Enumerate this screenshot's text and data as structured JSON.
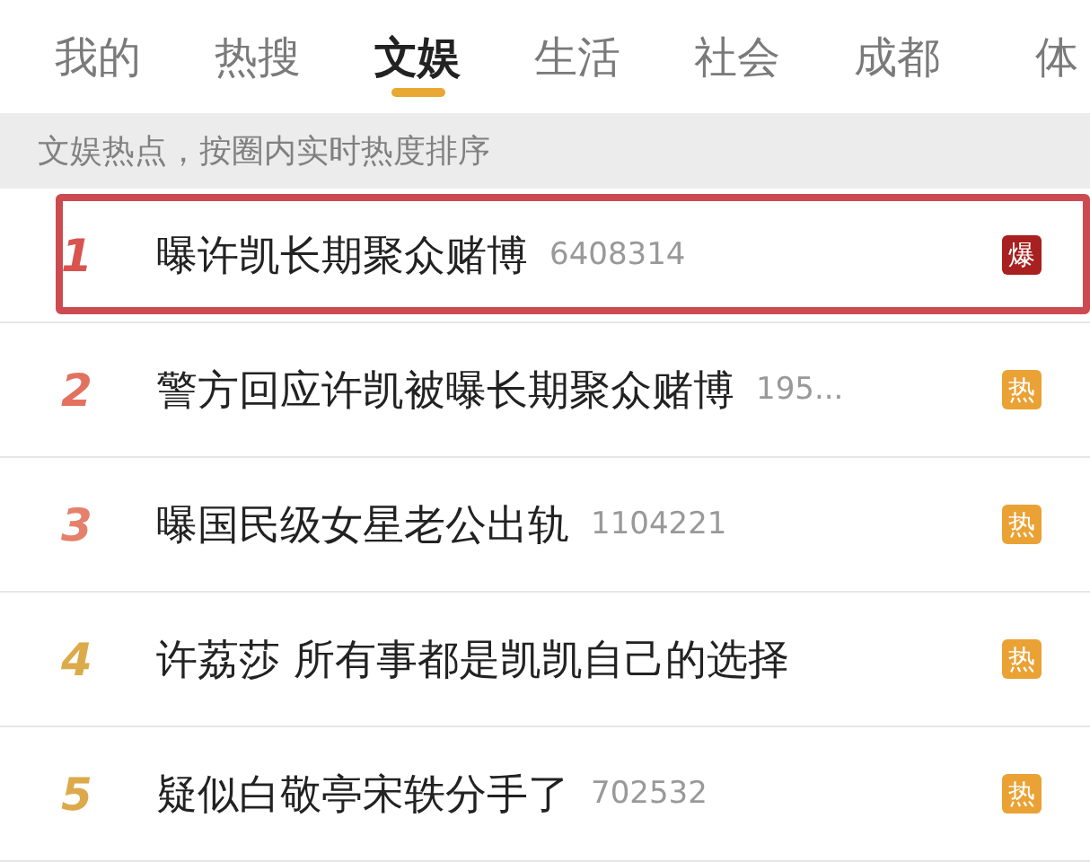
{
  "tabs": [
    {
      "label": "我的",
      "selected": false
    },
    {
      "label": "热搜",
      "selected": false
    },
    {
      "label": "文娱",
      "selected": true
    },
    {
      "label": "生活",
      "selected": false
    },
    {
      "label": "社会",
      "selected": false
    },
    {
      "label": "成都",
      "selected": false
    },
    {
      "label": "体",
      "selected": false
    }
  ],
  "notice": "文娱热点，按圈内实时热度排序",
  "rows": [
    {
      "rank": "1",
      "title": "曝许凯长期聚众赌博",
      "count": "6408314",
      "badge": {
        "kind": "explosive",
        "label": "爆"
      },
      "color": "#d9534f",
      "highlighted": true
    },
    {
      "rank": "2",
      "title": "警方回应许凯被曝长期聚众赌博",
      "count": "195...",
      "badge": {
        "kind": "hot",
        "label": "热"
      },
      "color": "#e2725f",
      "highlighted": false
    },
    {
      "rank": "3",
      "title": "曝国民级女星老公出轨",
      "count": "1104221",
      "badge": {
        "kind": "hot",
        "label": "热"
      },
      "color": "#e5806a",
      "highlighted": false
    },
    {
      "rank": "4",
      "title": "许荔莎 所有事都是凯凯自己的选择",
      "badge": {
        "kind": "hot",
        "label": "热"
      },
      "color": "#dcaa4a",
      "highlighted": false
    },
    {
      "rank": "5",
      "title": "疑似白敬亭宋轶分手了",
      "count": "702532",
      "badge": {
        "kind": "hot",
        "label": "热"
      },
      "color": "#dcaa4a",
      "highlighted": false
    }
  ]
}
